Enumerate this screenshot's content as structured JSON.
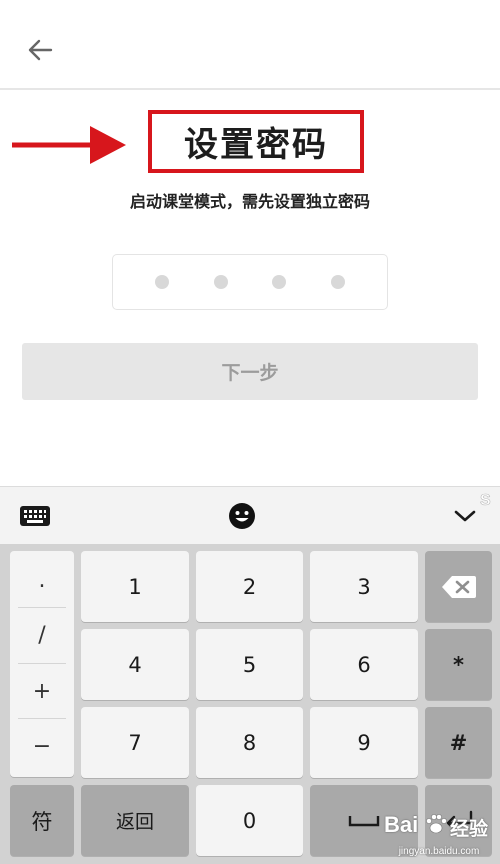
{
  "header": {
    "back_icon": "arrow-left-icon"
  },
  "main": {
    "title": "设置密码",
    "subtitle": "启动课堂模式，需先设置独立密码",
    "pin_dots": 4,
    "next_label": "下一步"
  },
  "annotation": {
    "color": "#d7161c"
  },
  "keyboard": {
    "toolbar": {
      "left_icon": "keyboard-icon",
      "center_icon": "emoji-icon",
      "right_icon": "chevron-down-icon"
    },
    "symbols": [
      ".",
      "/",
      "+",
      "−"
    ],
    "digits": {
      "k1": "1",
      "k2": "2",
      "k3": "3",
      "k4": "4",
      "k5": "5",
      "k6": "6",
      "k7": "7",
      "k8": "8",
      "k9": "9",
      "k0": "0"
    },
    "right": {
      "backspace_icon": "backspace-icon",
      "star": "*",
      "hash": "#",
      "enter_icon": "enter-icon"
    },
    "bottom": {
      "symbols_label": "符",
      "back_label": "返回",
      "space_icon": "space-icon"
    }
  },
  "watermark": {
    "brand": "Bai",
    "brand2": "经验",
    "url": "jingyan.baidu.com"
  }
}
